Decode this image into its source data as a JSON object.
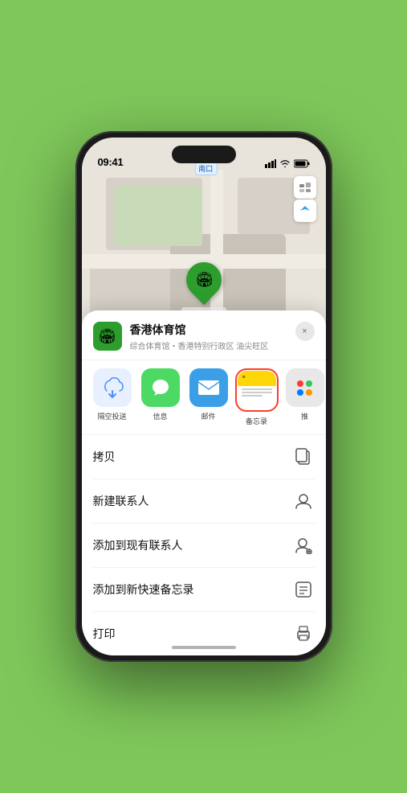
{
  "statusBar": {
    "time": "09:41",
    "locationIcon": "▶",
    "signalBars": "▐▐▐",
    "wifiIcon": "wifi",
    "batteryIcon": "battery"
  },
  "map": {
    "label": "南口",
    "markerName": "香港体育馆",
    "mapType": "map-type-icon",
    "locationIcon": "location-arrow-icon"
  },
  "venueSheet": {
    "venueName": "香港体育馆",
    "venueSubtitle": "综合体育馆・香港特别行政区 油尖旺区",
    "closeLabel": "×"
  },
  "shareItems": [
    {
      "id": "airdrop",
      "label": "隔空投送",
      "icon": "airdrop"
    },
    {
      "id": "messages",
      "label": "信息",
      "icon": "messages"
    },
    {
      "id": "mail",
      "label": "邮件",
      "icon": "mail"
    },
    {
      "id": "notes",
      "label": "备忘录",
      "icon": "notes"
    },
    {
      "id": "more",
      "label": "推",
      "icon": "more"
    }
  ],
  "actionItems": [
    {
      "id": "copy",
      "label": "拷贝",
      "icon": "copy"
    },
    {
      "id": "new-contact",
      "label": "新建联系人",
      "icon": "new-contact"
    },
    {
      "id": "add-existing",
      "label": "添加到现有联系人",
      "icon": "add-existing"
    },
    {
      "id": "add-notes",
      "label": "添加到新快速备忘录",
      "icon": "add-notes"
    },
    {
      "id": "print",
      "label": "打印",
      "icon": "print"
    }
  ],
  "colors": {
    "green": "#2d9e2d",
    "blue": "#3b9fe8",
    "red": "#ff3b30",
    "yellow": "#ffd60a"
  }
}
